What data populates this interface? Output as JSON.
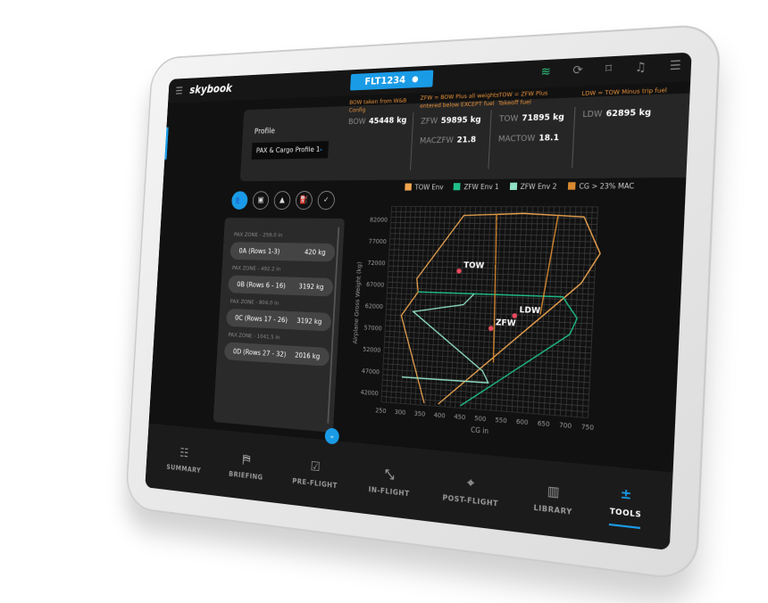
{
  "header": {
    "logo": "skybook",
    "flight": "FLT1234",
    "icons": [
      "wifi-icon",
      "sync-icon",
      "bookmark-icon",
      "bell-icon",
      "sliders-icon"
    ]
  },
  "summary": {
    "profile_label": "Profile",
    "profile_value": "PAX & Cargo Profile 1",
    "notes": {
      "bow": "BOW taken from W&B Config",
      "zfw": "ZFW = BOW Plus all weights entered below EXCEPT fuel",
      "tow": "TOW = ZFW Plus Takeoff fuel",
      "ldw": "LDW = TOW Minus trip fuel"
    },
    "bow": {
      "k": "BOW",
      "v": "45448 kg"
    },
    "zfw": {
      "k": "ZFW",
      "v": "59895 kg"
    },
    "maczfw": {
      "k": "MACZFW",
      "v": "21.8"
    },
    "tow": {
      "k": "TOW",
      "v": "71895 kg"
    },
    "mactow": {
      "k": "MACTOW",
      "v": "18.1"
    },
    "ldw": {
      "k": "LDW",
      "v": "62895 kg"
    }
  },
  "steps": [
    "pax-icon",
    "baggage-icon",
    "cargo-icon",
    "fuel-icon",
    "check-icon"
  ],
  "zones": [
    {
      "label": "PAX ZONE - 259.0 in",
      "name": "0A (Rows 1-3)",
      "weight": "420 kg"
    },
    {
      "label": "PAX ZONE - 492.2 in",
      "name": "0B (Rows 6 - 16)",
      "weight": "3192 kg"
    },
    {
      "label": "PAX ZONE - 804.0 in",
      "name": "0C (Rows 17 - 26)",
      "weight": "3192 kg"
    },
    {
      "label": "PAX ZONE - 1041.5 in",
      "name": "0D (Rows 27 - 32)",
      "weight": "2016 kg"
    }
  ],
  "nav": [
    {
      "label": "SUMMARY",
      "icon": "☷"
    },
    {
      "label": "BRIEFING",
      "icon": "⛿"
    },
    {
      "label": "PRE-FLIGHT",
      "icon": "☑"
    },
    {
      "label": "IN-FLIGHT",
      "icon": "⤡"
    },
    {
      "label": "POST-FLIGHT",
      "icon": "⌖"
    },
    {
      "label": "LIBRARY",
      "icon": "▥"
    },
    {
      "label": "TOOLS",
      "icon": "±",
      "active": true
    }
  ],
  "chart_data": {
    "type": "line",
    "xlabel": "CG in",
    "ylabel": "Airplane Gross Weight (kg)",
    "xlim": [
      250,
      750
    ],
    "ylim": [
      42000,
      82000
    ],
    "grid": true,
    "legend": "top",
    "xticks": [
      250,
      300,
      350,
      400,
      450,
      500,
      550,
      600,
      650,
      700,
      750
    ],
    "yticks": [
      42000,
      47000,
      52000,
      57000,
      62000,
      67000,
      72000,
      77000,
      82000
    ],
    "series": [
      {
        "name": "TOW Env",
        "color": "#f0a650",
        "points": [
          [
            360,
            40500
          ],
          [
            290,
            60000
          ],
          [
            330,
            65500
          ],
          [
            325,
            68500
          ],
          [
            435,
            83000
          ],
          [
            580,
            83500
          ],
          [
            720,
            82800
          ],
          [
            760,
            75000
          ],
          [
            720,
            68500
          ],
          [
            395,
            40500
          ]
        ]
      },
      {
        "name": "ZFW Env 1",
        "color": "#1fbf8a",
        "points": [
          [
            330,
            65500
          ],
          [
            680,
            65500
          ],
          [
            715,
            61000
          ],
          [
            700,
            57500
          ],
          [
            450,
            40500
          ]
        ]
      },
      {
        "name": "ZFW Env 2",
        "color": "#8fe0c4",
        "points": [
          [
            470,
            65500
          ],
          [
            445,
            63000
          ],
          [
            320,
            61000
          ],
          [
            500,
            48500
          ],
          [
            515,
            46000
          ],
          [
            300,
            46000
          ]
        ]
      },
      {
        "name": "CG > 23% MAC",
        "color": "#d9892e",
        "lines": [
          [
            [
              515,
              83300
            ],
            [
              525,
              50500
            ]
          ],
          [
            [
              660,
              82900
            ],
            [
              630,
              61500
            ]
          ]
        ]
      }
    ],
    "markers": [
      {
        "label": "TOW",
        "x": 430,
        "y": 70500
      },
      {
        "label": "ZFW",
        "x": 515,
        "y": 58000
      },
      {
        "label": "LDW",
        "x": 570,
        "y": 61000
      }
    ],
    "marker_color": "#e84a5f"
  }
}
